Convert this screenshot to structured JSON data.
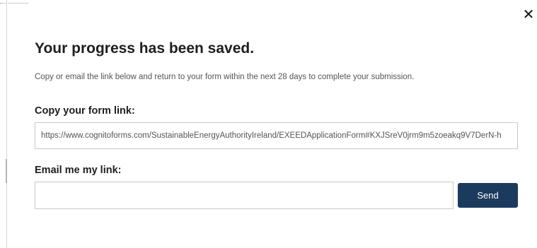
{
  "dialog": {
    "close_symbol": "✕",
    "title": "Your progress has been saved.",
    "subtitle": "Copy or email the link below and return to your form within the next 28 days to complete your submission.",
    "copy_section": {
      "label": "Copy your form link:",
      "link_value": "https://www.cognitoforms.com/SustainableEnergyAuthorityIreland/EXEEDApplicationForm#KXJSreV0jrm9m5zoeakq9V7DerN-h"
    },
    "email_section": {
      "label": "Email me my link:",
      "input_value": "",
      "send_label": "Send"
    }
  },
  "colors": {
    "button_bg": "#1b3a5e",
    "title_text": "#1e1e1e",
    "muted_text": "#555555",
    "field_border": "#c8c8c8"
  },
  "icons": {
    "close": "close-icon"
  }
}
